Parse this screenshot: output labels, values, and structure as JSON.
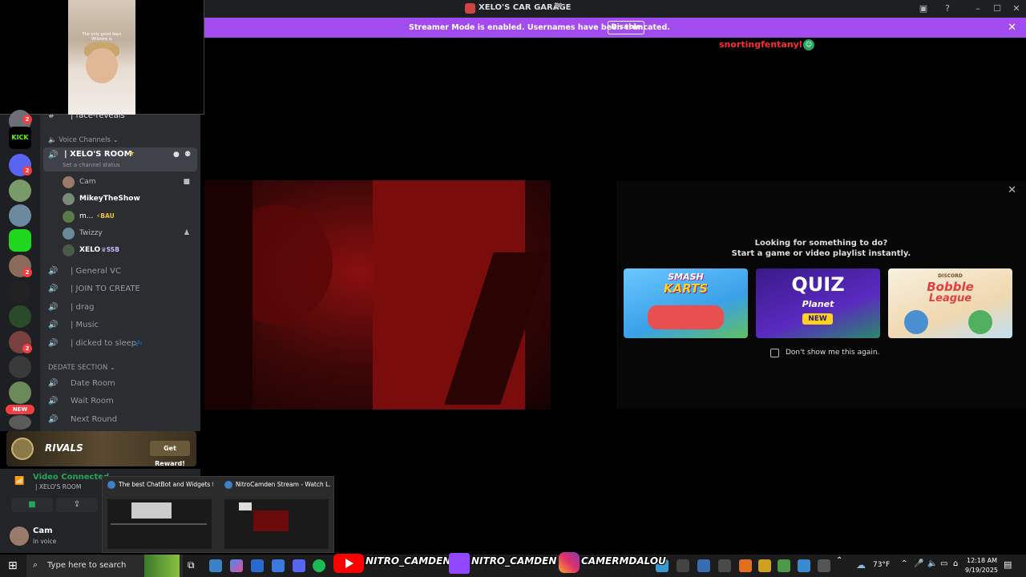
{
  "window": {
    "title": "XELO'S CAR GARAGE",
    "title_emoji": "🏁"
  },
  "banner": {
    "message": "Streamer Mode is enabled. Usernames have been truncated.",
    "disable_label": "Disable"
  },
  "stream_overlay_name": "snortingfentanyl",
  "webcam": {
    "caption": "The only good days Wilshire is"
  },
  "rail": {
    "badges": [
      "2",
      "2",
      "2",
      "2",
      "2"
    ],
    "new_label": "NEW",
    "kick_label": "KICK"
  },
  "channels": {
    "top_channel": "| face-reveals",
    "voice_category": "Voice Channels",
    "active_room": "| XELO'S ROOM",
    "active_room_status": "Set a channel status",
    "users": [
      {
        "name": "Cam",
        "tag": ""
      },
      {
        "name": "MikeyTheShow",
        "tag": ""
      },
      {
        "name": "m...",
        "tag": "BAU"
      },
      {
        "name": "Twizzy",
        "tag": ""
      },
      {
        "name": "XELO",
        "tag": "SSB"
      }
    ],
    "voice_list": [
      "| General VC",
      "| JOIN TO CREATE",
      "| drag",
      "| Music",
      "| dicked to sleep"
    ],
    "date_category": "DEDATE SECTION",
    "date_list": [
      "Date Room",
      "Wait Room",
      "Next Round"
    ]
  },
  "promo": {
    "brand": "RIVALS",
    "cta": "Get Reward!"
  },
  "voice_status": {
    "state": "Video Connected",
    "location": "| XELO'S ROOM",
    "user": "Cam",
    "user_status": "In voice"
  },
  "thumbnails": [
    {
      "title": "The best ChatBot and Widgets f..."
    },
    {
      "title": "NitroCamden Stream - Watch L..."
    }
  ],
  "activity": {
    "headline_1": "Looking for something to do?",
    "headline_2": "Start a game or video playlist instantly.",
    "games": [
      {
        "title_1": "SMASH",
        "title_2": "KARTS"
      },
      {
        "title_1": "QUIZ",
        "title_2": "Planet",
        "badge": "NEW"
      },
      {
        "title_1": "Bobble",
        "title_2": "League",
        "pre": "DISCORD"
      }
    ],
    "checkbox_label": "Don't show me this again."
  },
  "taskbar": {
    "search_placeholder": "Type here to search",
    "weather": "73°F",
    "time": "12:18 AM",
    "date": "9/19/2025"
  },
  "socials": [
    {
      "platform": "youtube-icon",
      "handle": "NITRO_CAMDEN"
    },
    {
      "platform": "twitch-icon",
      "handle": "NITRO_CAMDEN"
    },
    {
      "platform": "instagram-icon",
      "handle": "CAMERMDALOU"
    }
  ],
  "colors": {
    "discord_bg": "#2b2d31",
    "banner": "#a24cf0",
    "overlay_name": "#ff2d2d",
    "badge": "#f23f43",
    "online": "#23a55a"
  }
}
